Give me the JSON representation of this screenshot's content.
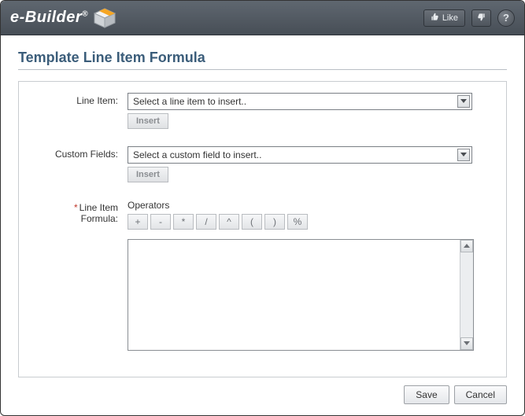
{
  "header": {
    "logo_text": "e-Builder",
    "like_label": "Like"
  },
  "page": {
    "title": "Template Line Item Formula"
  },
  "form": {
    "line_item": {
      "label": "Line Item:",
      "placeholder": "Select a line item to insert..",
      "insert_label": "Insert"
    },
    "custom_fields": {
      "label": "Custom Fields:",
      "placeholder": "Select a custom field to insert..",
      "insert_label": "Insert"
    },
    "formula": {
      "label_line1": "Line Item",
      "label_line2": "Formula:",
      "operators_label": "Operators",
      "ops": [
        "+",
        "-",
        "*",
        "/",
        "^",
        "(",
        ")",
        "%"
      ],
      "value": ""
    }
  },
  "footer": {
    "save_label": "Save",
    "cancel_label": "Cancel"
  }
}
